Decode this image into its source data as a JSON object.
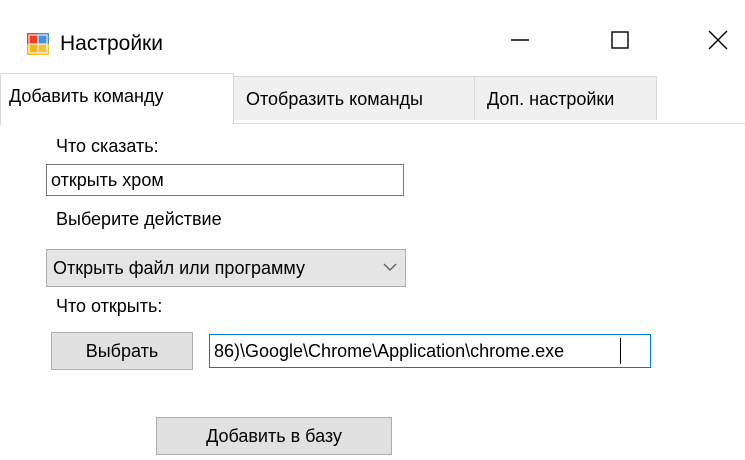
{
  "window": {
    "title": "Настройки"
  },
  "tabs": [
    {
      "label": "Добавить команду",
      "active": true
    },
    {
      "label": "Отобразить команды",
      "active": false
    },
    {
      "label": "Доп. настройки",
      "active": false
    }
  ],
  "form": {
    "say_label": "Что сказать:",
    "say_value": "открыть хром",
    "action_label": "Выберите действие",
    "action_selected": "Открыть файл или программу",
    "open_label": "Что открыть:",
    "browse_button": "Выбрать",
    "path_value": "86)\\Google\\Chrome\\Application\\chrome.exe",
    "add_button": "Добавить в базу"
  },
  "icons": {
    "app": "settings-app-icon",
    "minimize": "minimize-icon",
    "maximize": "maximize-icon",
    "close": "close-icon",
    "dropdown": "chevron-down-icon"
  },
  "colors": {
    "focus_border": "#0078d7",
    "button_face": "#e1e1e1"
  }
}
